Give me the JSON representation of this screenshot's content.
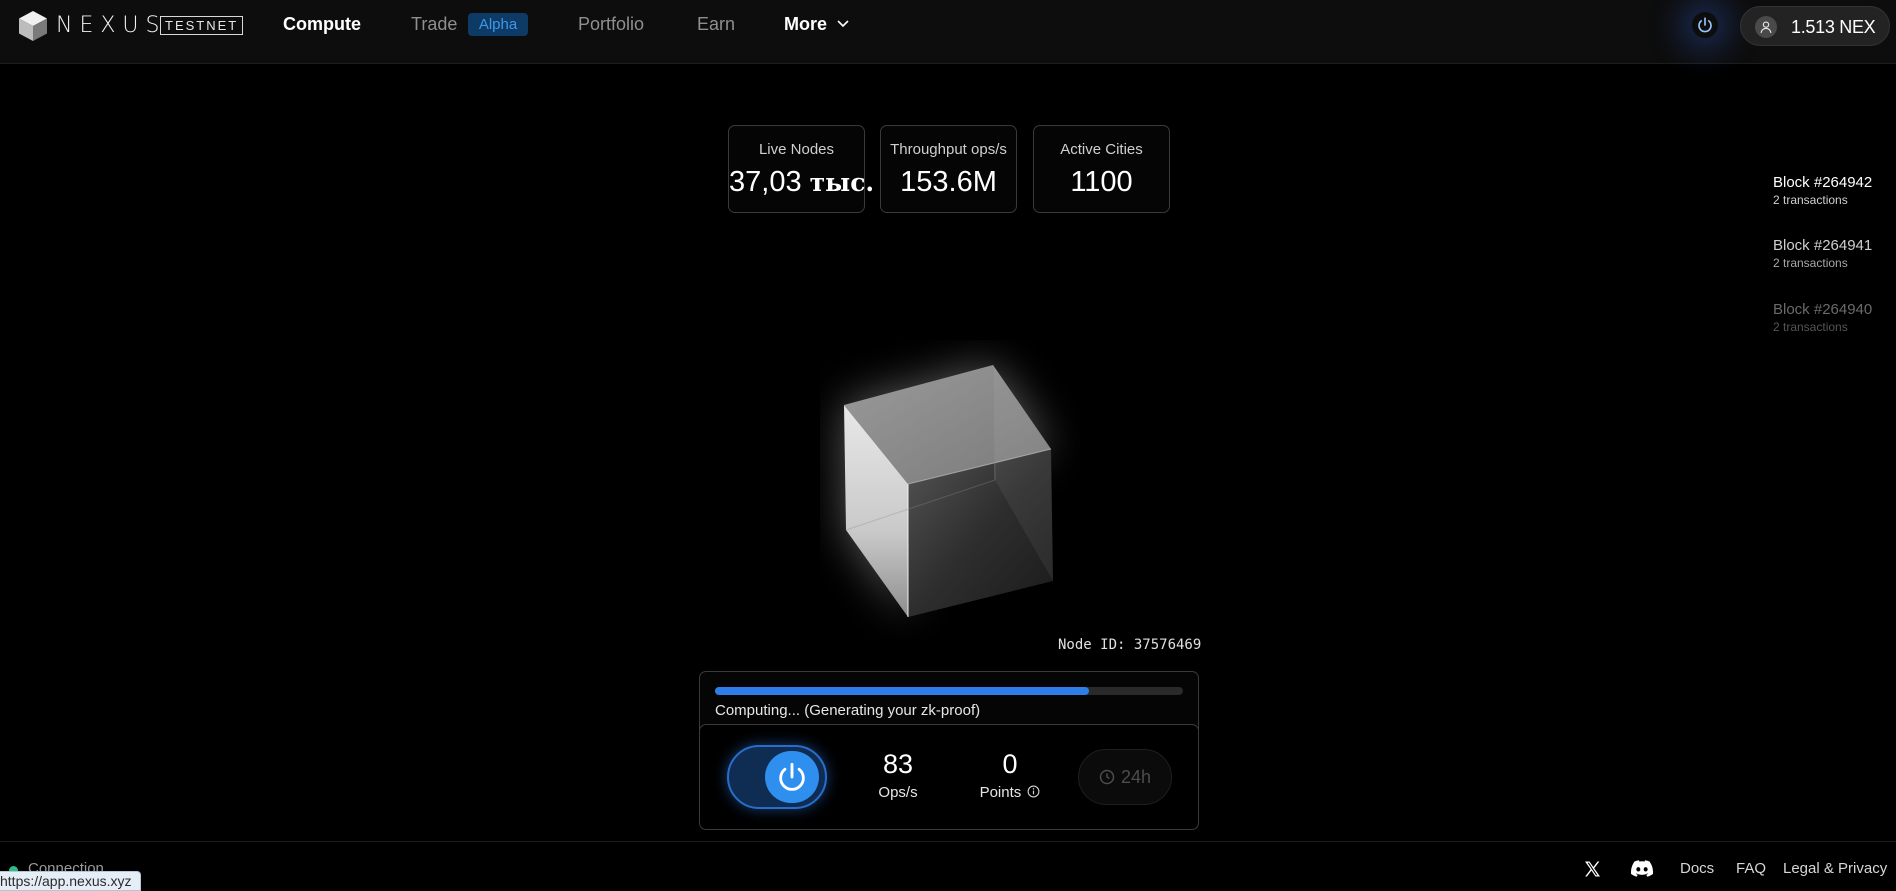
{
  "header": {
    "brand": "NEXUS",
    "network_badge": "TESTNET",
    "nav": [
      {
        "label": "Compute",
        "active": true
      },
      {
        "label": "Trade",
        "badge": "Alpha"
      },
      {
        "label": "Portfolio"
      },
      {
        "label": "Earn"
      },
      {
        "label": "More"
      }
    ],
    "wallet_balance": "1.513 NEX"
  },
  "stats": [
    {
      "label": "Live Nodes",
      "value": "37,03",
      "suffix": "тыс."
    },
    {
      "label": "Throughput ops/s",
      "value": "153.6M"
    },
    {
      "label": "Active Cities",
      "value": "1100"
    }
  ],
  "blocks": [
    {
      "title": "Block #264942",
      "sub": "2 transactions",
      "color": "#ffffff",
      "subcolor": "#d0d0d0"
    },
    {
      "title": "Block #264941",
      "sub": "2 transactions",
      "color": "#cfcfcf",
      "subcolor": "#a8a8a8"
    },
    {
      "title": "Block #264940",
      "sub": "2 transactions",
      "color": "#6a6a6a",
      "subcolor": "#555555"
    }
  ],
  "node_id": "Node ID: 37576469",
  "progress": {
    "fraction": 0.8,
    "text": "Computing... (Generating your zk-proof)"
  },
  "metrics": {
    "ops": {
      "value": "83",
      "label": "Ops/s"
    },
    "points": {
      "value": "0",
      "label": "Points"
    },
    "timer": "24h"
  },
  "footer": {
    "connection": "Connection",
    "url_tooltip": "https://app.nexus.xyz",
    "links": {
      "docs": "Docs",
      "faq": "FAQ",
      "legal": "Legal & Privacy"
    }
  },
  "colors": {
    "accent": "#2f7ee8",
    "status_ok": "#2bbf87",
    "alpha_badge": "#0e3a66"
  }
}
